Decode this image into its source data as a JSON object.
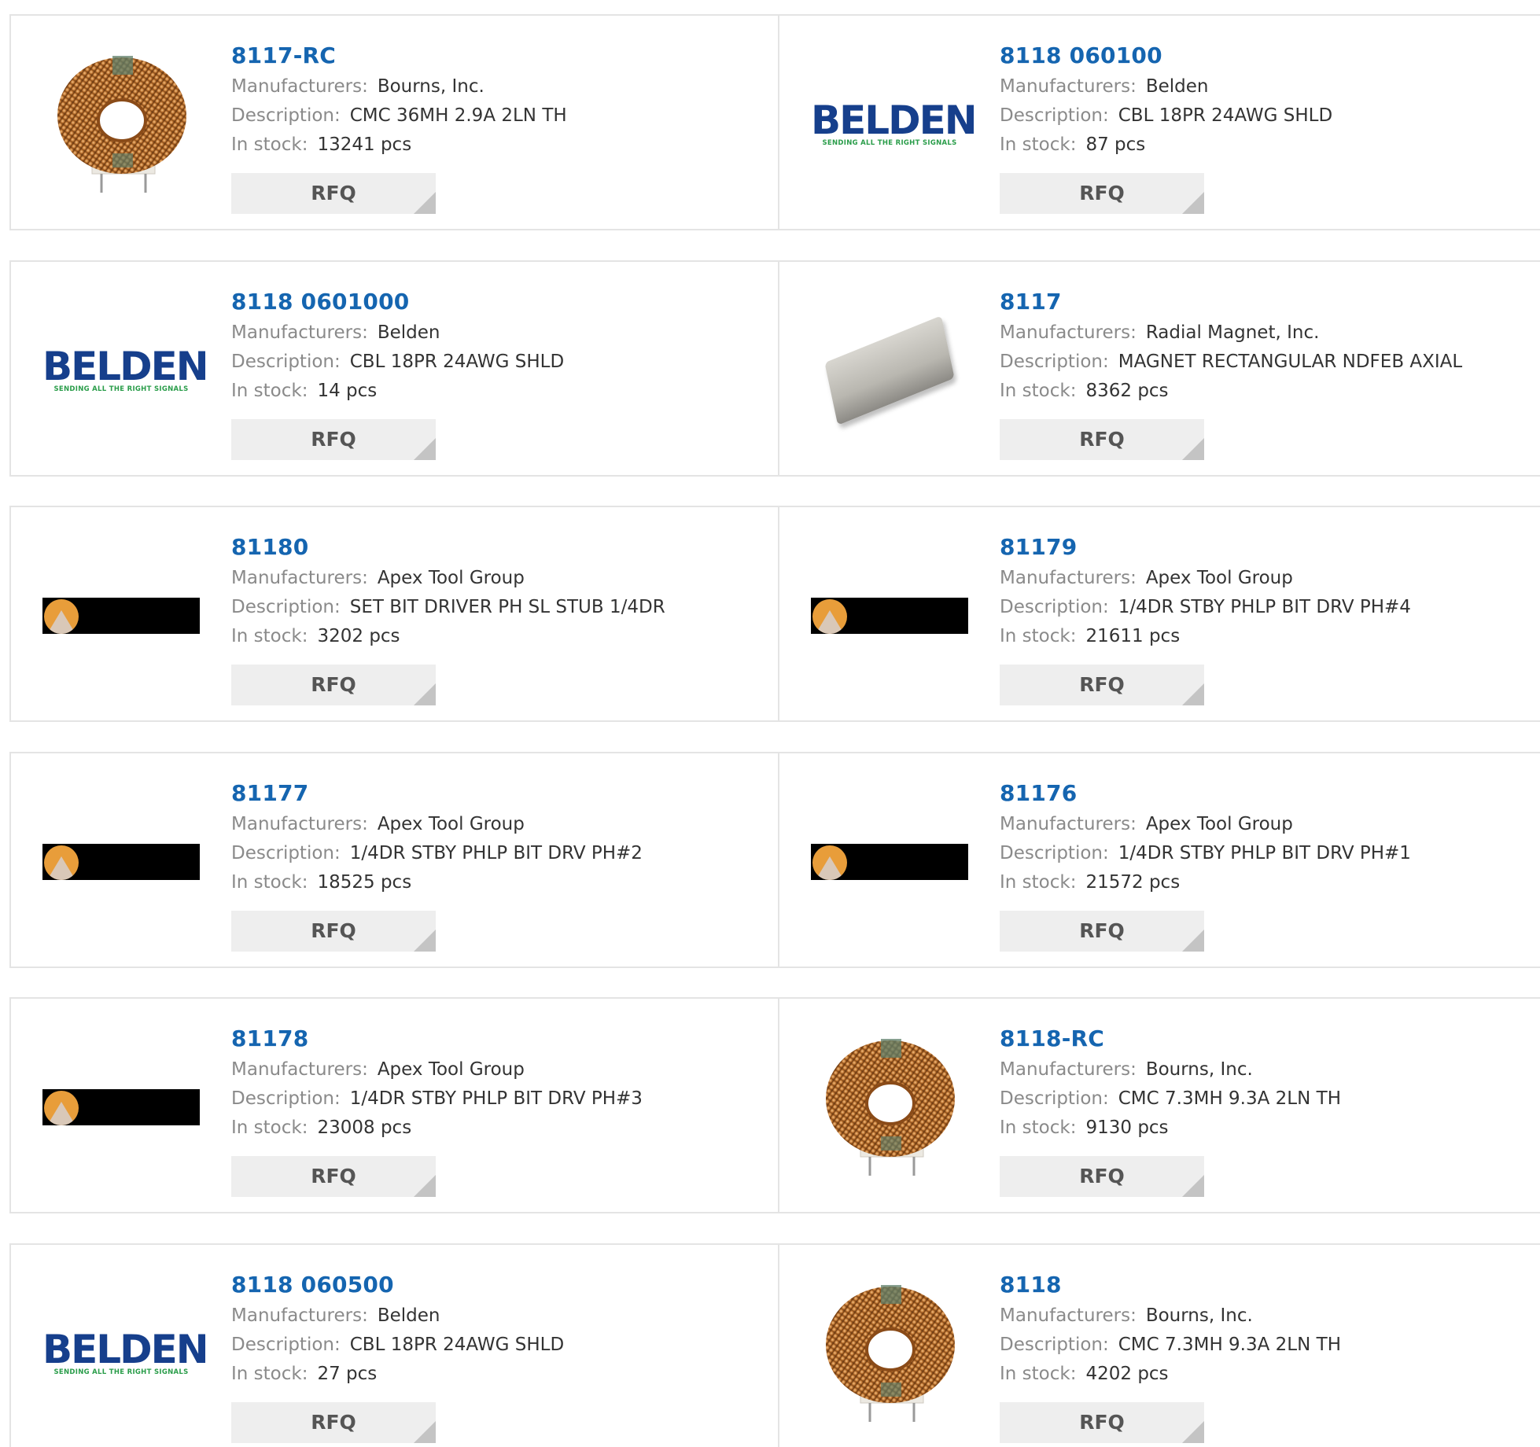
{
  "labels": {
    "manufacturers": "Manufacturers:",
    "description": "Description:",
    "in_stock": "In stock:",
    "rfq": "RFQ"
  },
  "products": [
    {
      "part": "8117-RC",
      "manufacturer": "Bourns, Inc.",
      "description": "CMC 36MH 2.9A 2LN TH",
      "stock": "13241 pcs",
      "image": "toroid-coil-icon"
    },
    {
      "part": "8118 060100",
      "manufacturer": "Belden",
      "description": "CBL 18PR 24AWG SHLD",
      "stock": "87 pcs",
      "image": "belden-logo",
      "logo_text": "BELDEN",
      "logo_tagline": "SENDING ALL THE RIGHT SIGNALS"
    },
    {
      "part": "8118 0601000",
      "manufacturer": "Belden",
      "description": "CBL 18PR 24AWG SHLD",
      "stock": "14 pcs",
      "image": "belden-logo",
      "logo_text": "BELDEN",
      "logo_tagline": "SENDING ALL THE RIGHT SIGNALS"
    },
    {
      "part": "8117",
      "manufacturer": "Radial Magnet, Inc.",
      "description": "MAGNET RECTANGULAR NDFEB AXIAL",
      "stock": "8362 pcs",
      "image": "magnet-icon"
    },
    {
      "part": "81180",
      "manufacturer": "Apex Tool Group",
      "description": "SET BIT DRIVER PH SL STUB 1/4DR",
      "stock": "3202 pcs",
      "image": "apex-logo"
    },
    {
      "part": "81179",
      "manufacturer": "Apex Tool Group",
      "description": "1/4DR STBY PHLP BIT DRV PH#4",
      "stock": "21611 pcs",
      "image": "apex-logo"
    },
    {
      "part": "81177",
      "manufacturer": "Apex Tool Group",
      "description": "1/4DR STBY PHLP BIT DRV PH#2",
      "stock": "18525 pcs",
      "image": "apex-logo"
    },
    {
      "part": "81176",
      "manufacturer": "Apex Tool Group",
      "description": "1/4DR STBY PHLP BIT DRV PH#1",
      "stock": "21572 pcs",
      "image": "apex-logo"
    },
    {
      "part": "81178",
      "manufacturer": "Apex Tool Group",
      "description": "1/4DR STBY PHLP BIT DRV PH#3",
      "stock": "23008 pcs",
      "image": "apex-logo"
    },
    {
      "part": "8118-RC",
      "manufacturer": "Bourns, Inc.",
      "description": "CMC 7.3MH 9.3A 2LN TH",
      "stock": "9130 pcs",
      "image": "toroid-coil-icon"
    },
    {
      "part": "8118 060500",
      "manufacturer": "Belden",
      "description": "CBL 18PR 24AWG SHLD",
      "stock": "27 pcs",
      "image": "belden-logo",
      "logo_text": "BELDEN",
      "logo_tagline": "SENDING ALL THE RIGHT SIGNALS"
    },
    {
      "part": "8118",
      "manufacturer": "Bourns, Inc.",
      "description": "CMC 7.3MH 9.3A 2LN TH",
      "stock": "4202 pcs",
      "image": "toroid-coil-icon"
    }
  ],
  "colors": {
    "part_link": "#1565b0",
    "label": "#8a8a8a",
    "value": "#333333",
    "border": "#e4e4e4",
    "rfq_bg": "#eeeeee"
  }
}
